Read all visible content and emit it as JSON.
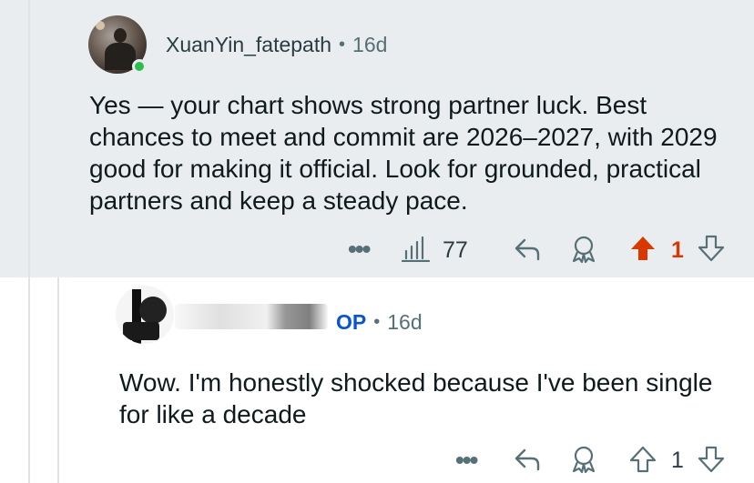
{
  "comment_1": {
    "username": "XuanYin_fatepath",
    "age": "16d",
    "text": "Yes — your chart shows strong partner luck. Best chances to meet and commit are 2026–2027, with 2029 good for making it official. Look for grounded, practical partners and keep a steady pace.",
    "insights_count": "77",
    "vote_count": "1",
    "upvoted": true
  },
  "comment_2": {
    "op_badge": "OP",
    "age": "16d",
    "text": "Wow. I'm honestly shocked because I've been single for like a decade",
    "vote_count": "1"
  },
  "meta_separator": "•",
  "icons": {
    "more": "more-icon",
    "insights": "bar-chart-icon",
    "reply": "reply-icon",
    "award": "award-icon",
    "upvote": "upvote-arrow-icon",
    "downvote": "downvote-arrow-icon"
  },
  "colors": {
    "highlight_bg": "#eaedef",
    "upvote_active": "#d93900",
    "op_badge": "#0a56c9",
    "online": "#2bbd4e"
  }
}
